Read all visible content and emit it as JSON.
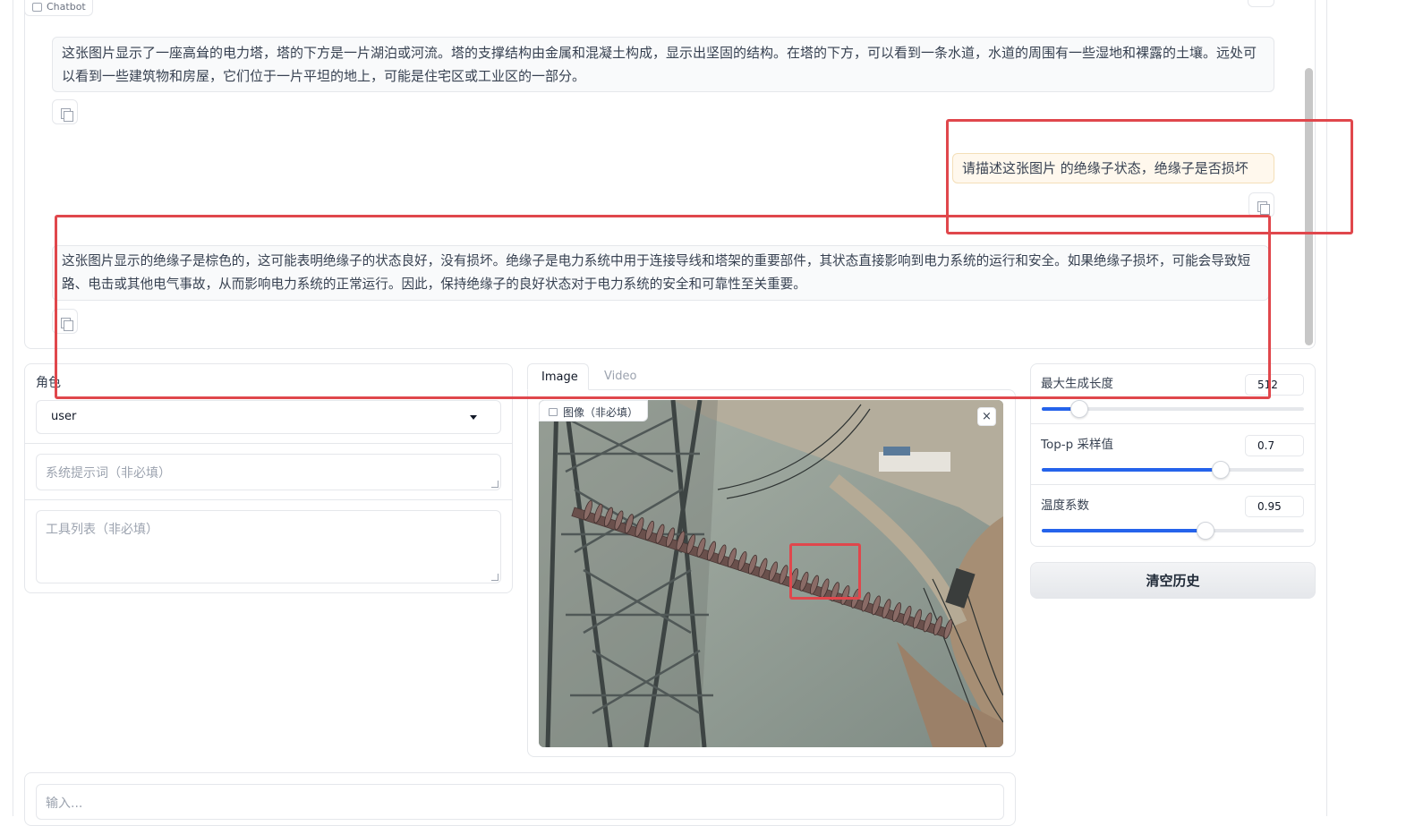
{
  "chatbot": {
    "label": "Chatbot",
    "messages": [
      {
        "role": "assistant",
        "text": "这张图片显示了一座高耸的电力塔，塔的下方是一片湖泊或河流。塔的支撑结构由金属和混凝土构成，显示出坚固的结构。在塔的下方，可以看到一条水道，水道的周围有一些湿地和裸露的土壤。远处可以看到一些建筑物和房屋，它们位于一片平坦的地上，可能是住宅区或工业区的一部分。"
      },
      {
        "role": "user",
        "text": "请描述这张图片 的绝缘子状态，绝缘子是否损坏"
      },
      {
        "role": "assistant",
        "text": "这张图片显示的绝缘子是棕色的，这可能表明绝缘子的状态良好，没有损坏。绝缘子是电力系统中用于连接导线和塔架的重要部件，其状态直接影响到电力系统的运行和安全。如果绝缘子损坏，可能会导致短路、电击或其他电气事故，从而影响电力系统的正常运行。因此，保持绝缘子的良好状态对于电力系统的安全和可靠性至关重要。"
      }
    ]
  },
  "role": {
    "label": "角色",
    "value": "user"
  },
  "system_prompt": {
    "placeholder": "系统提示词（非必填）"
  },
  "tools": {
    "placeholder": "工具列表（非必填）"
  },
  "media": {
    "tabs": [
      "Image",
      "Video"
    ],
    "active_tab": "Image",
    "image_label": "图像（非必填）",
    "close_glyph": "×"
  },
  "params": [
    {
      "label": "最大生成长度",
      "value": "512",
      "fraction": 0.14
    },
    {
      "label": "Top-p 采样值",
      "value": "0.7",
      "fraction": 0.68
    },
    {
      "label": "温度系数",
      "value": "0.95",
      "fraction": 0.62
    }
  ],
  "clear_button": "清空历史",
  "input": {
    "placeholder": "输入..."
  },
  "colors": {
    "accent": "#2563eb",
    "annotation": "#e0474c",
    "user_bubble": "#fff8ed"
  }
}
